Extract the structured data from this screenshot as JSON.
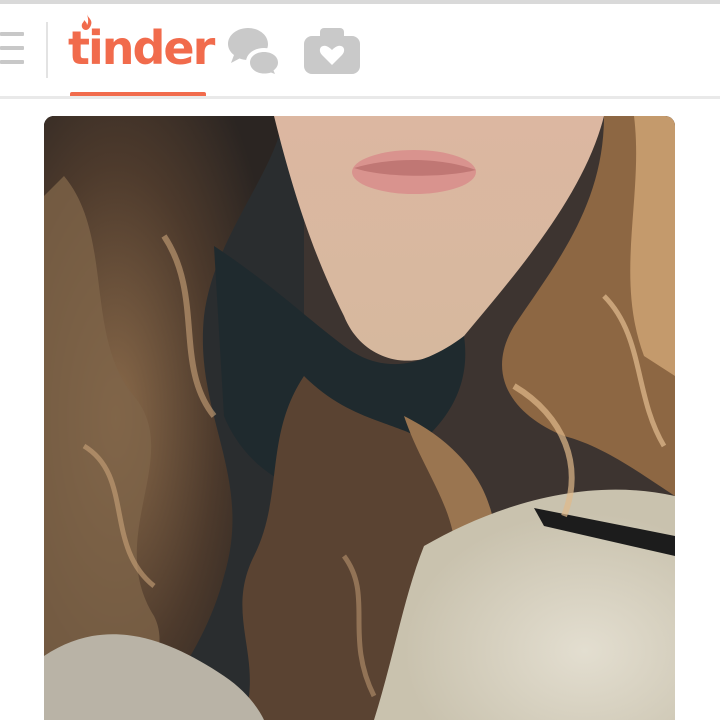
{
  "header": {
    "logo_text": "tinder",
    "menu_icon": "hamburger-menu-icon",
    "messages_icon": "chat-bubbles-icon",
    "moments_icon": "camera-heart-icon",
    "accent_color": "#f16b4c",
    "inactive_icon_color": "#c9c9c9"
  },
  "card": {
    "photo": "profile-photo"
  }
}
